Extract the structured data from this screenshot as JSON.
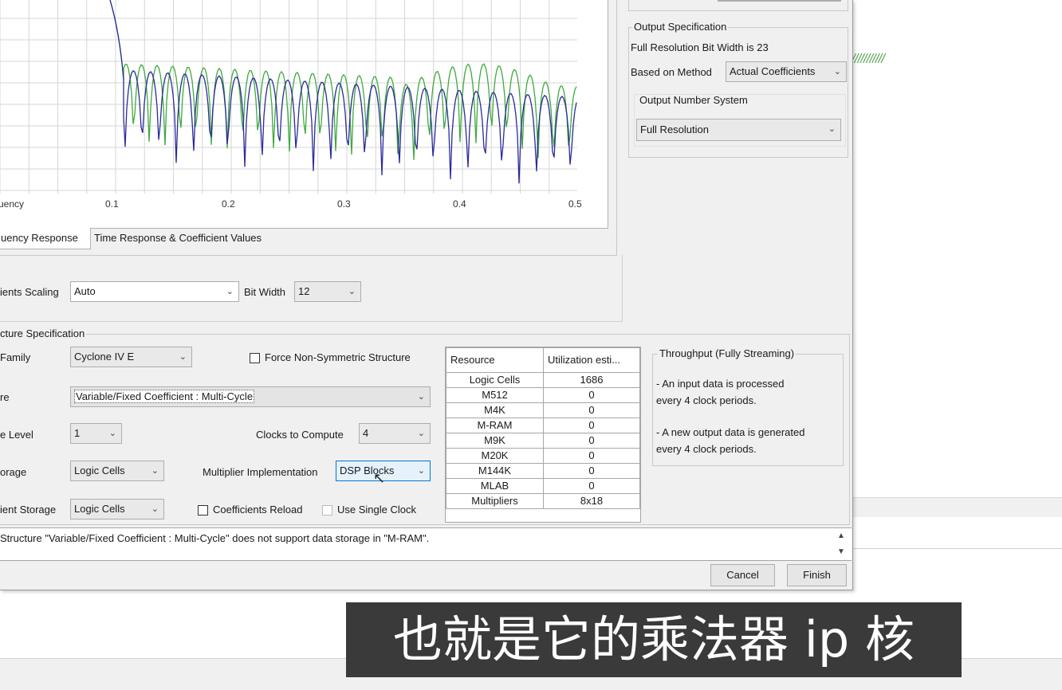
{
  "chart": {
    "tick_labels": [
      "uency",
      "0.1",
      "0.2",
      "0.3",
      "0.4",
      "0.5"
    ],
    "colors": {
      "series_a": "#2a2a9a",
      "series_b": "#3daa3d"
    }
  },
  "tabs": [
    {
      "label": "uency Response",
      "active": true
    },
    {
      "label": "Time Response & Coefficient Values",
      "active": false
    }
  ],
  "coeff_row": {
    "scaling_label": "ients Scaling",
    "scaling_value": "Auto",
    "bit_width_label": "Bit Width",
    "bit_width_value": "12"
  },
  "output_spec": {
    "title": "Output Specification",
    "bit_width_text": "Full Resolution Bit Width is 23",
    "method_label": "Based on Method",
    "method_value": "Actual Coefficients",
    "number_system_label": "Output Number System",
    "number_system_value": "Full Resolution"
  },
  "structure_spec": {
    "title": "cture Specification",
    "family_label": "Family",
    "family_value": "Cyclone IV E",
    "force_non_symmetric_label": "Force Non-Symmetric Structure",
    "structure_label": "re",
    "structure_value": "Variable/Fixed Coefficient : Multi-Cycle",
    "level_label": "e Level",
    "level_value": "1",
    "clocks_label": "Clocks to Compute",
    "clocks_value": "4",
    "storage_label": "orage",
    "storage_value": "Logic Cells",
    "multiplier_label": "Multiplier Implementation",
    "multiplier_value": "DSP Blocks",
    "coeff_storage_label": "ient Storage",
    "coeff_storage_value": "Logic Cells",
    "coeff_reload_label": "Coefficients Reload",
    "single_clock_label": "Use Single Clock"
  },
  "resource_table": {
    "headers": [
      "Resource",
      "Utilization esti..."
    ],
    "rows": [
      [
        "Logic Cells",
        "1686"
      ],
      [
        "M512",
        "0"
      ],
      [
        "M4K",
        "0"
      ],
      [
        "M-RAM",
        "0"
      ],
      [
        "M9K",
        "0"
      ],
      [
        "M20K",
        "0"
      ],
      [
        "M144K",
        "0"
      ],
      [
        "MLAB",
        "0"
      ],
      [
        "Multipliers",
        "8x18"
      ]
    ]
  },
  "throughput": {
    "title": "Throughput (Fully Streaming)",
    "line1": "- An input data is processed",
    "line2": "every 4 clock periods.",
    "line3": "- A new output data is generated",
    "line4": "every 4 clock periods."
  },
  "status_message": "Structure \"Variable/Fixed Coefficient : Multi-Cycle\" does not support data storage in \"M-RAM\".",
  "buttons": {
    "cancel": "Cancel",
    "finish": "Finish"
  },
  "caption": "也就是它的乘法器 ip 核"
}
